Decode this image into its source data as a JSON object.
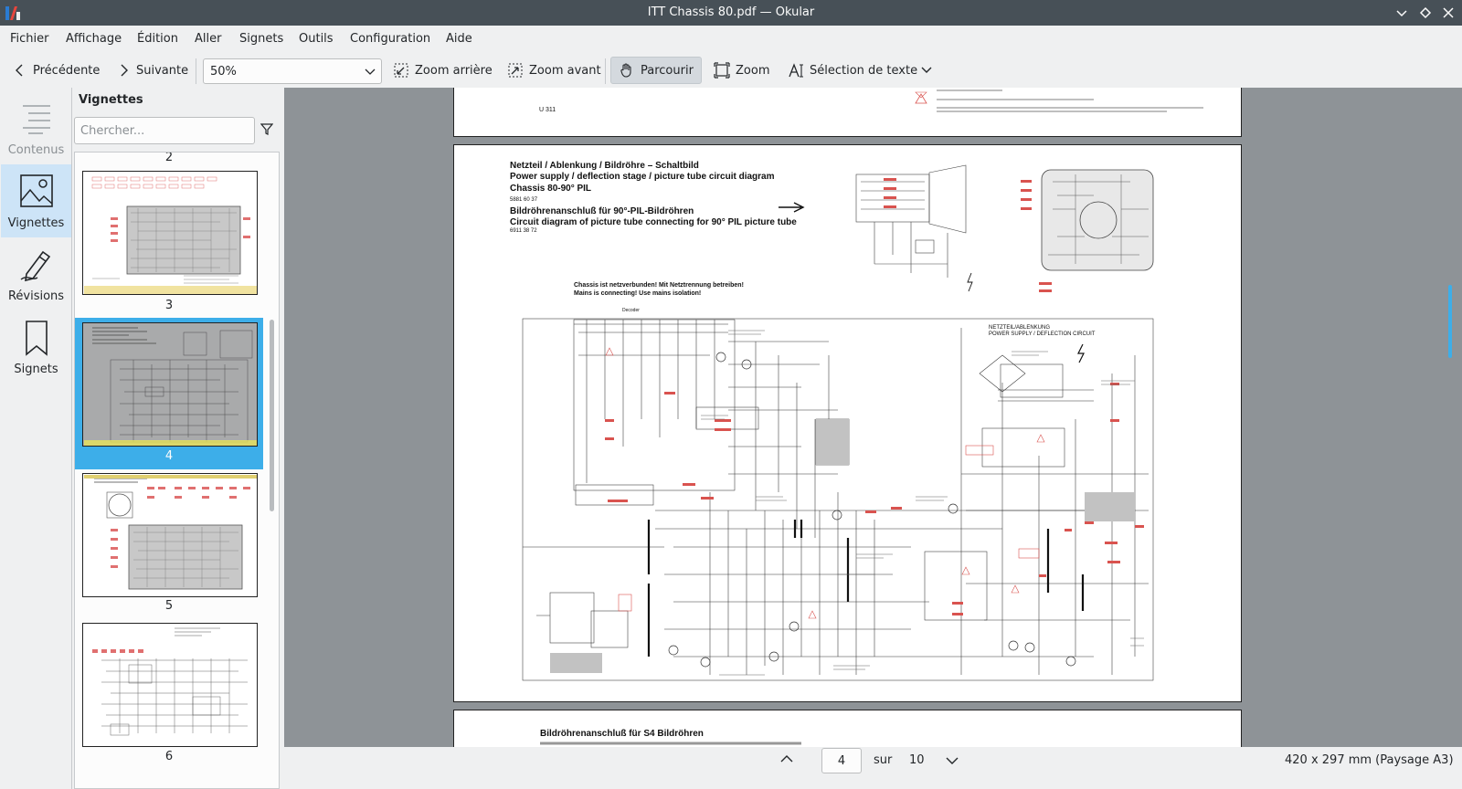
{
  "window": {
    "title": "ITT Chassis 80.pdf — Okular"
  },
  "menu": [
    "Fichier",
    "Affichage",
    "Édition",
    "Aller",
    "Signets",
    "Outils",
    "Configuration",
    "Aide"
  ],
  "toolbar": {
    "prev_label": "Précédente",
    "next_label": "Suivante",
    "zoom_value": "50%",
    "zoom_out_label": "Zoom arrière",
    "zoom_in_label": "Zoom avant",
    "browse_label": "Parcourir",
    "zoom_label": "Zoom",
    "text_select_label": "Sélection de texte"
  },
  "sidebar": {
    "tabs": [
      {
        "label": "Contenus",
        "icon": "table-of-contents-icon",
        "active": false
      },
      {
        "label": "Vignettes",
        "icon": "image-icon",
        "active": true
      },
      {
        "label": "Révisions",
        "icon": "pen-icon",
        "active": false
      },
      {
        "label": "Signets",
        "icon": "bookmark-icon",
        "active": false
      }
    ]
  },
  "thumbnails": {
    "header": "Vignettes",
    "search_placeholder": "Chercher...",
    "pages": [
      "2",
      "3",
      "4",
      "5",
      "6"
    ],
    "selected_page": "4"
  },
  "document": {
    "page3_footer_code": "U 311",
    "page4": {
      "title_de": "Netzteil / Ablenkung / Bildröhre – Schaltbild",
      "title_en": "Power supply / deflection stage / picture tube circuit diagram",
      "chassis": "Chassis 80-90° PIL",
      "code1": "5881 60 37",
      "sub_de": "Bildröhrenanschluß für 90°-PIL-Bildröhren",
      "sub_en": "Circuit diagram of picture tube connecting for 90° PIL picture tube",
      "code2": "6911 38 72",
      "warning_de": "Chassis ist netzverbunden! Mit Netztrennung betreiben!",
      "warning_en": "Mains is connecting! Use mains isolation!",
      "block_label": "NETZTEIL/ABLENKUNG",
      "block_label_en": "POWER SUPPLY / DEFLECTION CIRCUIT",
      "decoder_label": "Decoder"
    },
    "page5_title": "Bildröhrenanschluß für S4 Bildröhren"
  },
  "statusbar": {
    "current_page": "4",
    "of_label": "sur",
    "total_pages": "10",
    "page_size": "420 x 297 mm (Paysage A3)"
  },
  "colors": {
    "accent": "#3daee9",
    "titlebar": "#475057",
    "viewer_bg": "#8e9397",
    "schematic_red": "#d9534f"
  }
}
